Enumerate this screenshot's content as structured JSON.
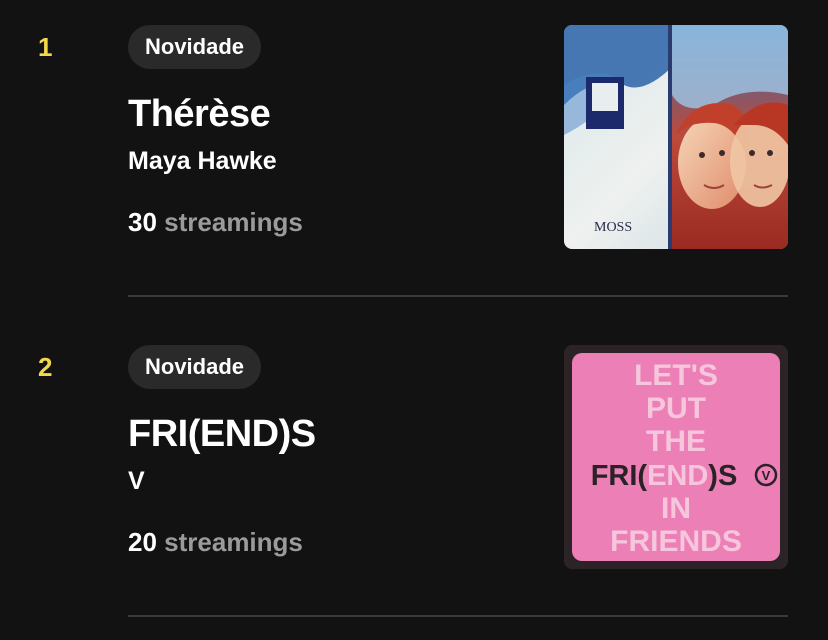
{
  "chart": {
    "items": [
      {
        "rank": "1",
        "badge": "Novidade",
        "title": "Thérèse",
        "artist": "Maya Hawke",
        "stream_count": "30",
        "stream_unit": "streamings",
        "cover_text": "MOSS"
      },
      {
        "rank": "2",
        "badge": "Novidade",
        "title": "FRI(END)S",
        "artist": "V",
        "stream_count": "20",
        "stream_unit": "streamings",
        "cover_text": {
          "line1": "LET'S",
          "line2": "PUT",
          "line3": "THE",
          "line4_a": "FRI(",
          "line4_b": "END",
          "line4_c": ")S",
          "line4_logo": "V",
          "line5": "IN",
          "line6": "FRIENDS"
        }
      }
    ]
  },
  "colors": {
    "background": "#121212",
    "rank": "#f2d74f",
    "badge_bg": "#2a2a2a",
    "stream_unit": "#9b9b9b",
    "divider": "#3a3a3a",
    "cover2_pink": "#ec7fb6"
  }
}
